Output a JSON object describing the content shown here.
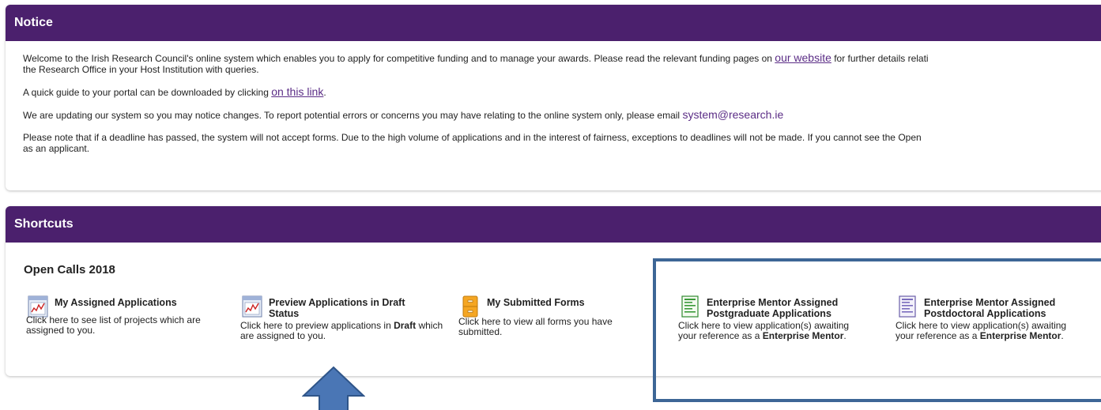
{
  "notice": {
    "header": "Notice",
    "p1_line1_a": "Welcome to the Irish Research Council's online system which enables you to apply for competitive funding and to manage your awards. Please read the relevant funding pages on ",
    "p1_link": "our website",
    "p1_line1_b": " for further details relati",
    "p1_line2": "the Research Office in your Host Institution with queries.",
    "p2_text": "A quick guide to your portal can be downloaded by clicking ",
    "p2_link": "on this link",
    "p2_end": ".",
    "p3_text": "We are updating our system so you may notice changes. To report potential errors or concerns you may have relating to the online system only, please email ",
    "p3_email": "system@research.ie",
    "p4_line1": "Please note that if a deadline has passed, the system will not accept forms. Due to the high volume of applications and in the interest of fairness, exceptions to deadlines will not be made. If you cannot see the Open",
    "p4_line2": "as an applicant."
  },
  "shortcuts": {
    "header": "Shortcuts",
    "calls_title": "Open Calls 2018",
    "items": [
      {
        "title": "My Assigned Applications",
        "desc_a": "Click here to see list of projects which are assigned to you.",
        "icon": "report-chart-icon"
      },
      {
        "title": "Preview Applications in Draft Status",
        "desc_a": "Click here to preview applications in ",
        "desc_bold": "Draft",
        "desc_b": " which are assigned to you.",
        "icon": "report-chart-icon"
      },
      {
        "title": "My Submitted Forms",
        "desc_a": "Click here to view all forms you have submitted.",
        "icon": "filing-cabinet-icon"
      },
      {
        "title": "Enterprise Mentor Assigned Postgraduate Applications",
        "desc_a": "Click here to view application(s) awaiting your reference as a ",
        "desc_bold": "Enterprise Mentor",
        "desc_b": ".",
        "icon": "green-document-icon"
      },
      {
        "title": "Enterprise Mentor Assigned Postdoctoral Applications",
        "desc_a": "Click here to view application(s) awaiting your reference as a ",
        "desc_bold": "Enterprise Mentor",
        "desc_b": ".",
        "icon": "purple-document-icon"
      }
    ]
  },
  "colors": {
    "header_bg": "#4b206d",
    "link": "#5b2d86",
    "highlight_box": "#3d6696",
    "arrow_fill": "#4a76b5"
  }
}
